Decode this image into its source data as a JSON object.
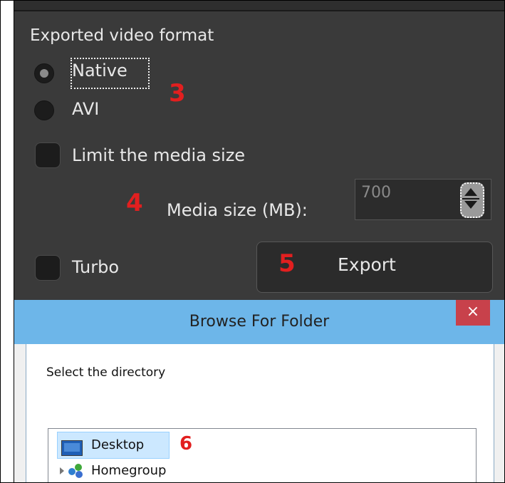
{
  "export_panel": {
    "section_title": "Exported video format",
    "formats": [
      {
        "label": "Native",
        "selected": true
      },
      {
        "label": "AVI",
        "selected": false
      }
    ],
    "limit_size_label": "Limit the media size",
    "limit_size_checked": false,
    "media_size_label": "Media size (MB):",
    "media_size_value": "700",
    "turbo_label": "Turbo",
    "turbo_checked": false,
    "export_label": "Export"
  },
  "annotations": {
    "step_format": "3",
    "step_media_size": "4",
    "step_export": "5",
    "step_directory": "6",
    "color": "#e21f1f"
  },
  "browse_dialog": {
    "title": "Browse For Folder",
    "close_symbol": "×",
    "instruction": "Select the directory",
    "tree_items": [
      {
        "label": "Desktop",
        "icon": "desktop-icon",
        "selected": true
      },
      {
        "label": "Homegroup",
        "icon": "homegroup-icon",
        "selected": false
      }
    ],
    "titlebar_color": "#6db6e9",
    "close_color": "#c8414b"
  }
}
